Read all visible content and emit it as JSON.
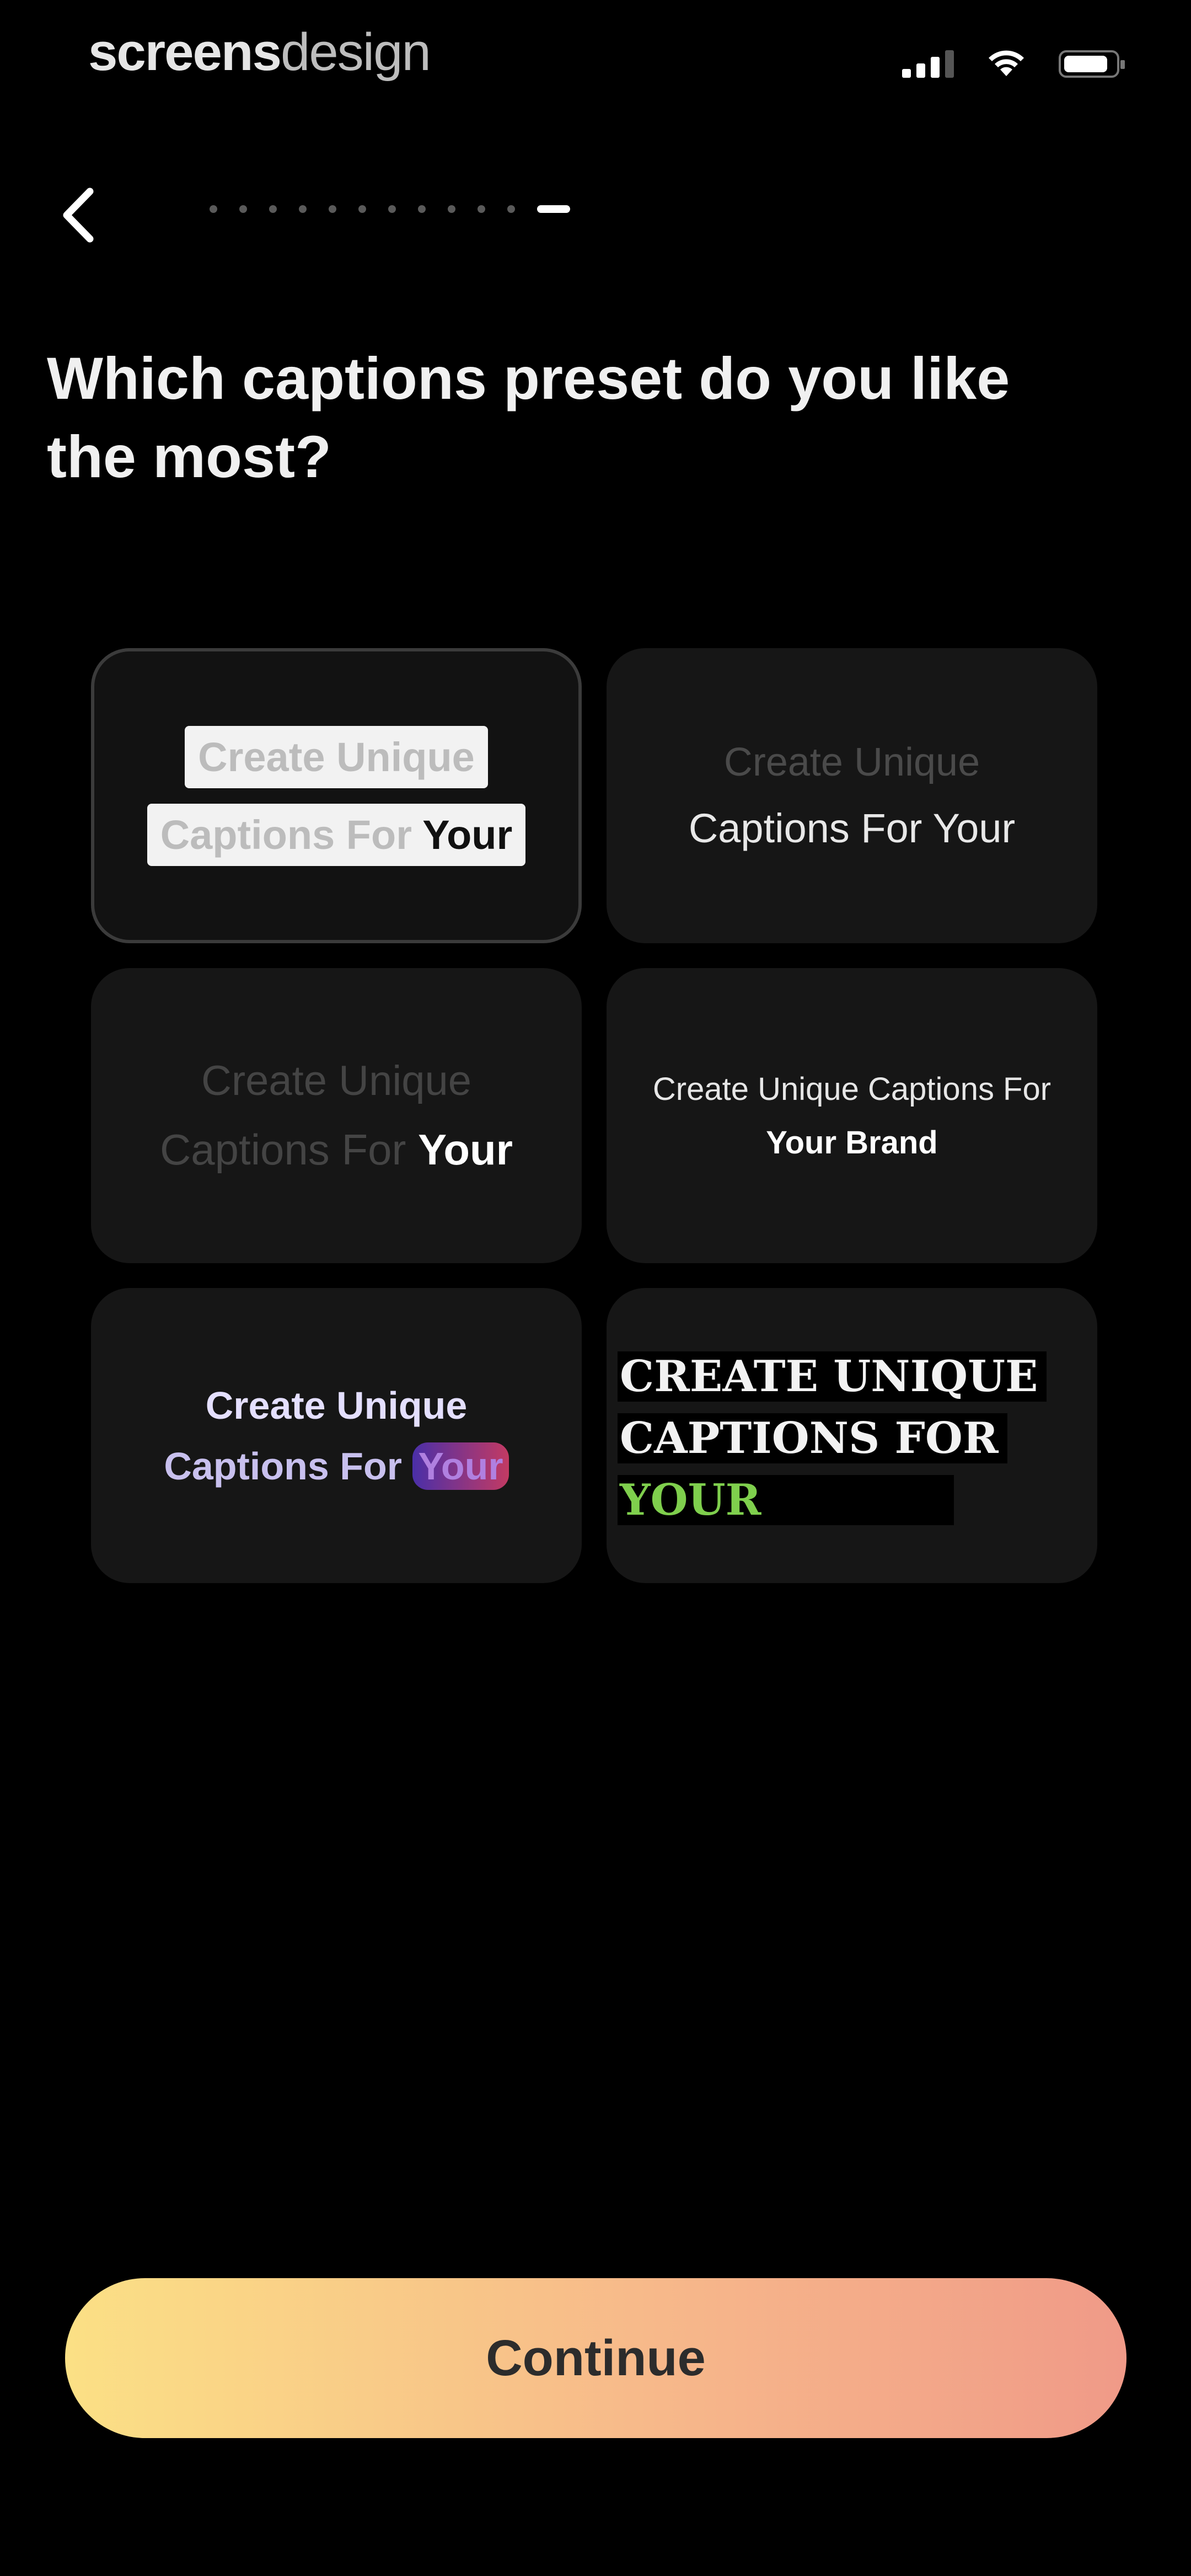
{
  "status_bar": {
    "brand_bold": "screens",
    "brand_light": "design"
  },
  "header": {
    "title": "Which captions preset do you like the most?",
    "progress": {
      "total_steps": 12,
      "current_step": 12
    }
  },
  "presets": [
    {
      "line1": "Create Unique",
      "line2_start": "Captions For ",
      "line2_emph": "Your"
    },
    {
      "line1": "Create Unique",
      "line2": "Captions For Your"
    },
    {
      "line1": "Create Unique",
      "line2_start": "Captions For ",
      "line2_emph": "Your"
    },
    {
      "line1": "Create Unique Captions For",
      "line2": "Your Brand"
    },
    {
      "line1": "Create Unique",
      "line2_start": "Captions For ",
      "line2_emph": "Your"
    },
    {
      "line1": "CREATE UNIQUE",
      "line2": "CAPTIONS FOR",
      "line3": "YOUR"
    }
  ],
  "selected_preset_index": 0,
  "footer": {
    "continue_label": "Continue"
  },
  "colors": {
    "background": "#000000",
    "card": "#161616",
    "button_gradient_start": "#fbe085",
    "button_gradient_end": "#f09a88",
    "accent_green": "#7fcf4d"
  }
}
